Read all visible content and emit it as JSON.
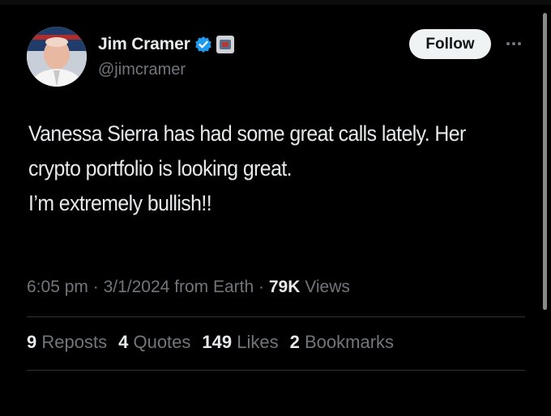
{
  "author": {
    "display_name": "Jim Cramer",
    "handle": "@jimcramer"
  },
  "icons": {
    "verified": "verified-badge-icon",
    "affiliate": "affiliate-badge-icon",
    "more": "more-options-icon"
  },
  "colors": {
    "background": "#000000",
    "verified_blue": "#1d9bf0",
    "muted_text": "#71767b",
    "primary_text": "#e7e9ea"
  },
  "follow_button": {
    "label": "Follow"
  },
  "tweet": {
    "lines": [
      "Vanessa Sierra has had some great calls lately. Her",
      "crypto portfolio is looking great.",
      "I’m extremely bullish!!"
    ]
  },
  "meta": {
    "time": "6:05 pm",
    "separator1": " · ",
    "date": "3/1/2024",
    "source": " from Earth",
    "separator2": " · ",
    "views_count": "79K",
    "views_label": " Views"
  },
  "stats": [
    {
      "count": "9",
      "label": "Reposts"
    },
    {
      "count": "4",
      "label": "Quotes"
    },
    {
      "count": "149",
      "label": "Likes"
    },
    {
      "count": "2",
      "label": "Bookmarks"
    }
  ]
}
